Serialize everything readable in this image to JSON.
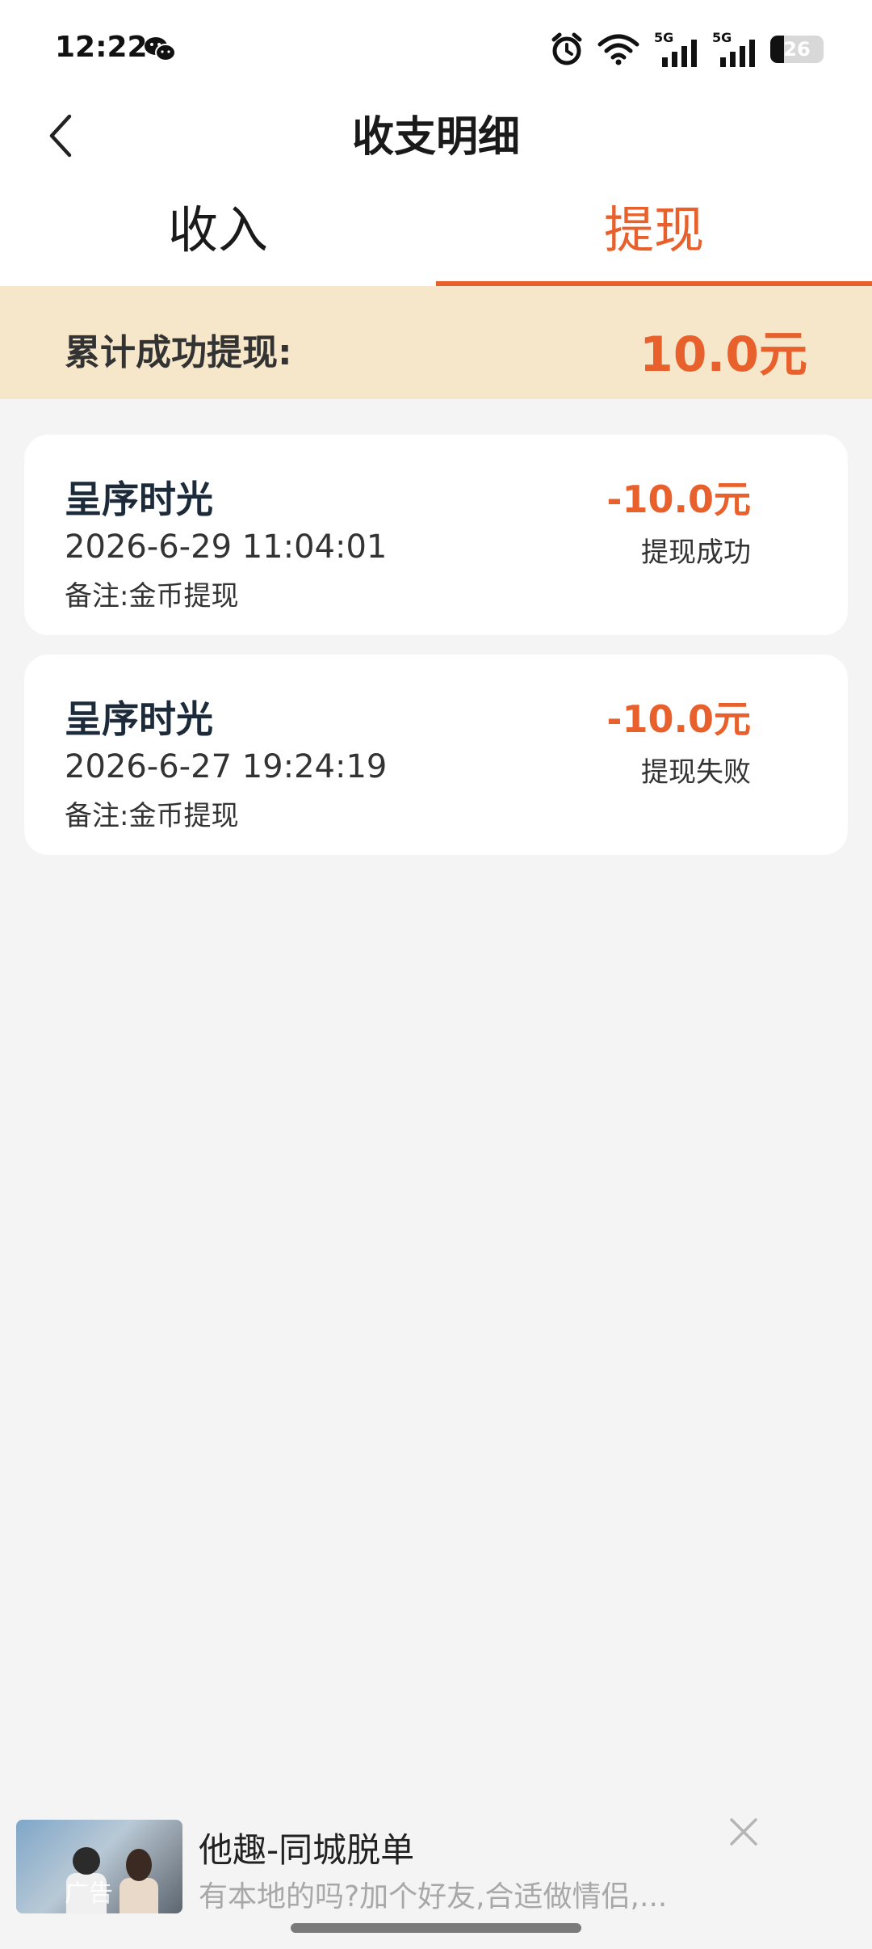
{
  "status_bar": {
    "time": "12:22",
    "battery_level": "26",
    "battery_fraction": 0.26,
    "icons": [
      "wechat-icon",
      "alarm-icon",
      "wifi-icon",
      "signal-5g-icon",
      "signal-5g-icon",
      "battery-icon"
    ],
    "network_label_1": "5G",
    "network_label_2": "5G"
  },
  "header": {
    "title": "收支明细",
    "back_icon": "chevron-left-icon"
  },
  "tabs": [
    {
      "label": "收入",
      "active": false
    },
    {
      "label": "提现",
      "active": true
    }
  ],
  "summary": {
    "label": "累计成功提现:",
    "value": "10.0元"
  },
  "records": [
    {
      "name": "呈序时光",
      "time": "2026-6-29 11:04:01",
      "note": "备注:金币提现",
      "amount": "-10.0元",
      "status": "提现成功"
    },
    {
      "name": "呈序时光",
      "time": "2026-6-27 19:24:19",
      "note": "备注:金币提现",
      "amount": "-10.0元",
      "status": "提现失败"
    }
  ],
  "ad": {
    "tag": "广告",
    "title": "他趣-同城脱单",
    "description": "有本地的吗?加个好友,合适做情侣,...",
    "close_icon": "close-icon"
  },
  "colors": {
    "accent": "#e8602c",
    "summary_bg": "#f7e7ca",
    "page_bg": "#f4f4f4"
  }
}
